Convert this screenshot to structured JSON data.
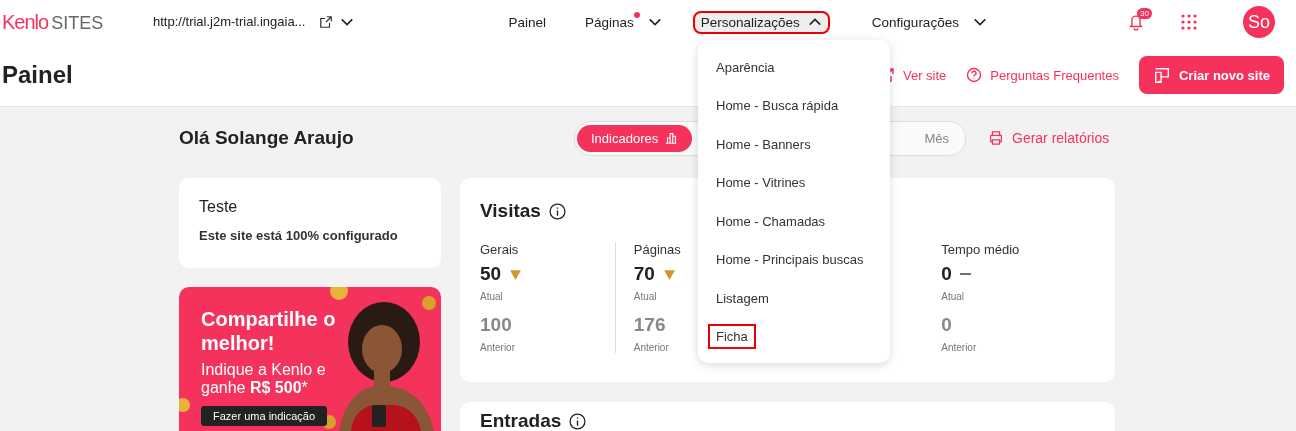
{
  "logo": {
    "brand": "Kenlo",
    "product": "SITES"
  },
  "site_url": "http://trial.j2m-trial.ingaia...",
  "nav": [
    {
      "label": "Painel",
      "has_menu": false,
      "expanded": false,
      "dot": false,
      "highlighted": false
    },
    {
      "label": "Páginas",
      "has_menu": true,
      "expanded": false,
      "dot": true,
      "highlighted": false
    },
    {
      "label": "Personalizações",
      "has_menu": true,
      "expanded": true,
      "dot": false,
      "highlighted": true
    },
    {
      "label": "Configurações",
      "has_menu": true,
      "expanded": false,
      "dot": false,
      "highlighted": false
    }
  ],
  "notifications": {
    "count": "30"
  },
  "avatar": {
    "initials": "So"
  },
  "page_title": "Painel",
  "header_links": [
    "Ver site",
    "Perguntas Frequentes"
  ],
  "primary_button": "Criar novo site",
  "greeting": "Olá Solange Araujo",
  "view_toggle": [
    {
      "label": "Indicadores",
      "selected": true
    },
    {
      "label": "Mês",
      "selected": false
    }
  ],
  "report_link": "Gerar relatórios",
  "site_card": {
    "name": "Teste",
    "status": "Este site está 100% configurado"
  },
  "promo": {
    "title": "Compartilhe o melhor!",
    "text": "Indique a Kenlo e ganhe **R$ 500***",
    "button": "Fazer uma indicação"
  },
  "visits": {
    "title": "Visitas",
    "metrics": [
      {
        "label": "Gerais",
        "current": "50",
        "kind": "down",
        "current_label": "Atual",
        "previous": "100",
        "previous_label": "Anterior"
      },
      {
        "label": "Páginas",
        "current": "70",
        "kind": "down",
        "current_label": "Atual",
        "previous": "176",
        "previous_label": "Anterior"
      },
      {
        "label": "Tempo médio",
        "current": "0",
        "kind": "flat",
        "current_label": "Atual",
        "previous": "0",
        "previous_label": "Anterior"
      }
    ]
  },
  "entries": {
    "title": "Entradas"
  },
  "dropdown": [
    {
      "label": "Aparência",
      "highlighted": false
    },
    {
      "label": "Home - Busca rápida",
      "highlighted": false
    },
    {
      "label": "Home - Banners",
      "highlighted": false
    },
    {
      "label": "Home - Vitrines",
      "highlighted": false
    },
    {
      "label": "Home - Chamadas",
      "highlighted": false
    },
    {
      "label": "Home - Principais buscas",
      "highlighted": false
    },
    {
      "label": "Listagem",
      "highlighted": false
    },
    {
      "label": "Ficha",
      "highlighted": true
    }
  ]
}
